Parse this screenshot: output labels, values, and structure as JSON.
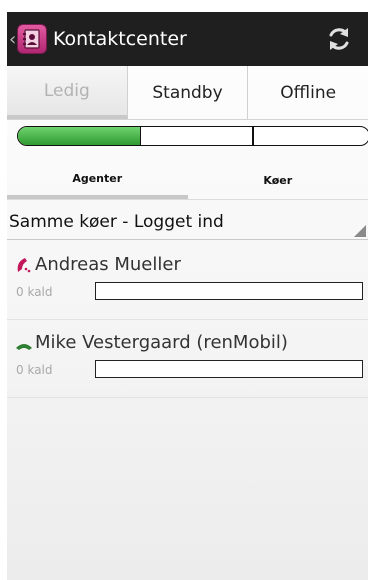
{
  "app": {
    "title": "Kontaktcenter",
    "icons": {
      "up": "up-caret-icon",
      "app": "contact-book-icon",
      "refresh": "refresh-icon"
    }
  },
  "status_tabs": [
    {
      "label": "Ledig",
      "selected": true
    },
    {
      "label": "Standby",
      "selected": false
    },
    {
      "label": "Offline",
      "selected": false
    }
  ],
  "status_bar": {
    "fill_fraction": 0.35,
    "segments": 3,
    "fill_color": "#3caa3c"
  },
  "sub_tabs": [
    {
      "label": "Agenter",
      "selected": true
    },
    {
      "label": "Køer",
      "selected": false
    }
  ],
  "filter": {
    "selected": "Samme køer - Logget ind"
  },
  "agents": [
    {
      "name": "Andreas Mueller",
      "calls": "0 kald",
      "phone_state": "busy",
      "phone_color": "#c2185b"
    },
    {
      "name": "Mike Vestergaard (renMobil)",
      "calls": "0 kald",
      "phone_state": "idle",
      "phone_color": "#2e7d32"
    }
  ]
}
